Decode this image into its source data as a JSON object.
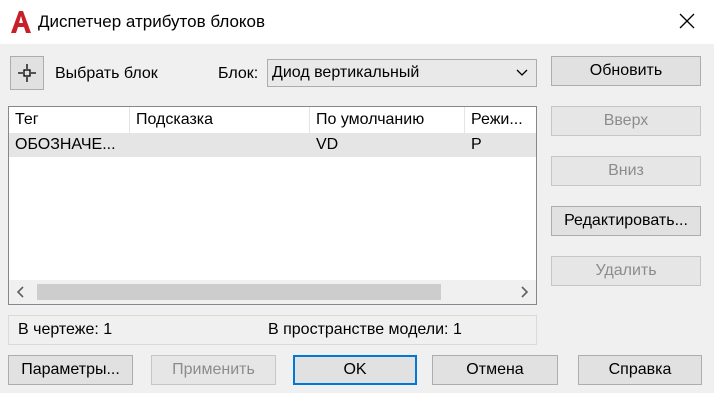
{
  "window": {
    "title": "Диспетчер атрибутов блоков",
    "icon": "autocad-a-icon",
    "close_icon": "close-icon"
  },
  "toolbar": {
    "select_block_label": "Выбрать блок",
    "block_label": "Блок:",
    "block_value": "Диод вертикальный",
    "pick_icon": "crosshair-pick-icon",
    "dropdown_icon": "chevron-down-icon"
  },
  "table": {
    "columns": [
      "Тег",
      "Подсказка",
      "По умолчанию",
      "Режи..."
    ],
    "rows": [
      {
        "tag": "ОБОЗНАЧЕ...",
        "prompt": "",
        "default": "VD",
        "mode": "P"
      }
    ]
  },
  "side_buttons": {
    "sync": "Обновить",
    "up": "Вверх",
    "down": "Вниз",
    "edit": "Редактировать...",
    "remove": "Удалить"
  },
  "status": {
    "in_drawing": "В чертеже: 1",
    "in_model_space": "В пространстве модели: 1"
  },
  "bottom_buttons": {
    "settings": "Параметры...",
    "apply": "Применить",
    "ok": "OK",
    "cancel": "Отмена",
    "help": "Справка"
  },
  "colors": {
    "accent": "#0078d7",
    "app_icon": "#c8202a",
    "dialog_bg": "#f0f0f0"
  }
}
